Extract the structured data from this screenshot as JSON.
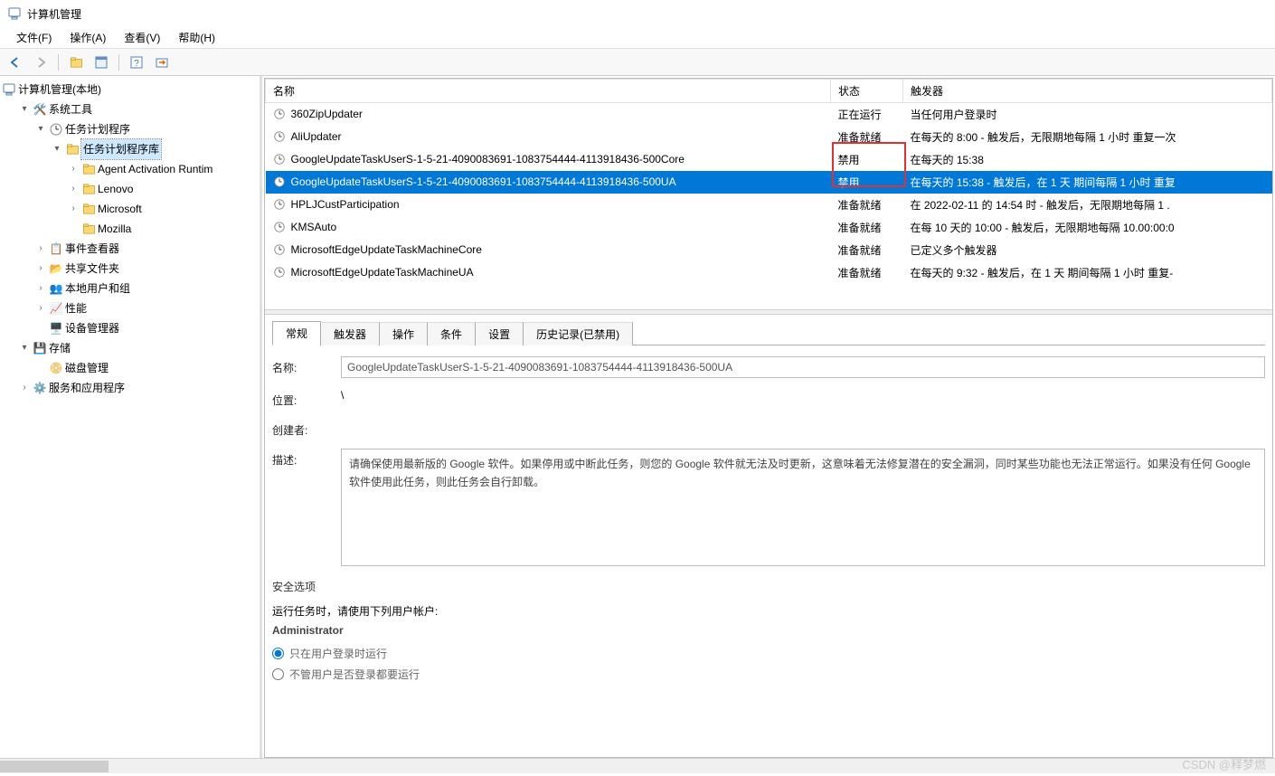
{
  "window": {
    "title": "计算机管理"
  },
  "menu": {
    "file": "文件(F)",
    "action": "操作(A)",
    "view": "查看(V)",
    "help": "帮助(H)"
  },
  "toolbar_names": {
    "back": "back-icon",
    "forward": "forward-icon",
    "refresh": "refresh-icon",
    "properties": "properties-icon",
    "help": "help-icon",
    "export": "export-icon"
  },
  "tree": {
    "root": "计算机管理(本地)",
    "system_tools": "系统工具",
    "task_sched": "任务计划程序",
    "task_lib": "任务计划程序库",
    "lib_children": [
      "Agent Activation Runtim",
      "Lenovo",
      "Microsoft",
      "Mozilla"
    ],
    "event_viewer": "事件查看器",
    "shared_folders": "共享文件夹",
    "local_users": "本地用户和组",
    "performance": "性能",
    "device_mgr": "设备管理器",
    "storage": "存储",
    "disk_mgmt": "磁盘管理",
    "services": "服务和应用程序"
  },
  "task_columns": {
    "name": "名称",
    "status": "状态",
    "trigger": "触发器"
  },
  "tasks": [
    {
      "name": "360ZipUpdater",
      "status": "正在运行",
      "trigger": "当任何用户登录时"
    },
    {
      "name": "AliUpdater",
      "status": "准备就绪",
      "trigger": "在每天的 8:00 - 触发后，无限期地每隔 1 小时 重复一次"
    },
    {
      "name": "GoogleUpdateTaskUserS-1-5-21-4090083691-1083754444-4113918436-500Core",
      "status": "禁用",
      "trigger": "在每天的 15:38"
    },
    {
      "name": "GoogleUpdateTaskUserS-1-5-21-4090083691-1083754444-4113918436-500UA",
      "status": "禁用",
      "trigger": "在每天的 15:38 - 触发后，在 1 天 期间每隔 1 小时 重复"
    },
    {
      "name": "HPLJCustParticipation",
      "status": "准备就绪",
      "trigger": "在 2022-02-11 的 14:54 时 - 触发后，无限期地每隔 1 ."
    },
    {
      "name": "KMSAuto",
      "status": "准备就绪",
      "trigger": "在每 10 天的 10:00 - 触发后，无限期地每隔 10.00:00:0"
    },
    {
      "name": "MicrosoftEdgeUpdateTaskMachineCore",
      "status": "准备就绪",
      "trigger": "已定义多个触发器"
    },
    {
      "name": "MicrosoftEdgeUpdateTaskMachineUA",
      "status": "准备就绪",
      "trigger": "在每天的 9:32 - 触发后，在 1 天 期间每隔 1 小时 重复-"
    }
  ],
  "details_tabs": [
    "常规",
    "触发器",
    "操作",
    "条件",
    "设置",
    "历史记录(已禁用)"
  ],
  "details": {
    "name_lbl": "名称:",
    "name_val": "GoogleUpdateTaskUserS-1-5-21-4090083691-1083754444-4113918436-500UA",
    "loc_lbl": "位置:",
    "loc_val": "\\",
    "author_lbl": "创建者:",
    "author_val": "",
    "desc_lbl": "描述:",
    "desc_val": "请确保使用最新版的 Google 软件。如果停用或中断此任务，则您的 Google 软件就无法及时更新，这意味着无法修复潜在的安全漏洞，同时某些功能也无法正常运行。如果没有任何 Google 软件使用此任务，则此任务会自行卸载。",
    "sec_title": "安全选项",
    "run_as_label": "运行任务时，请使用下列用户帐户:",
    "run_as_user": "Administrator",
    "radio_logged_in": "只在用户登录时运行",
    "radio_any": "不管用户是否登录都要运行"
  },
  "watermark": "CSDN @释梦燃"
}
